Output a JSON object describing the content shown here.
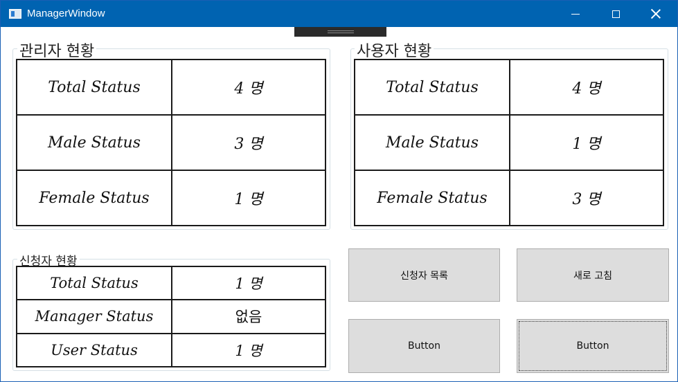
{
  "window": {
    "title": "ManagerWindow"
  },
  "admin_panel": {
    "header": "관리자 현황",
    "rows": [
      {
        "label": "Total Status",
        "value": "4 명"
      },
      {
        "label": "Male Status",
        "value": "3 명"
      },
      {
        "label": "Female Status",
        "value": "1 명"
      }
    ]
  },
  "user_panel": {
    "header": "사용자 현황",
    "rows": [
      {
        "label": "Total Status",
        "value": "4 명"
      },
      {
        "label": "Male Status",
        "value": "1 명"
      },
      {
        "label": "Female Status",
        "value": "3 명"
      }
    ]
  },
  "applicant_panel": {
    "header": "신청자 현황",
    "rows": [
      {
        "label": "Total Status",
        "value": "1 명"
      },
      {
        "label": "Manager Status",
        "value": "없음"
      },
      {
        "label": "User Status",
        "value": "1 명"
      }
    ]
  },
  "buttons": {
    "applicant_list": "신청자 목록",
    "refresh": "새로 고침",
    "button_1": "Button",
    "button_2": "Button"
  }
}
